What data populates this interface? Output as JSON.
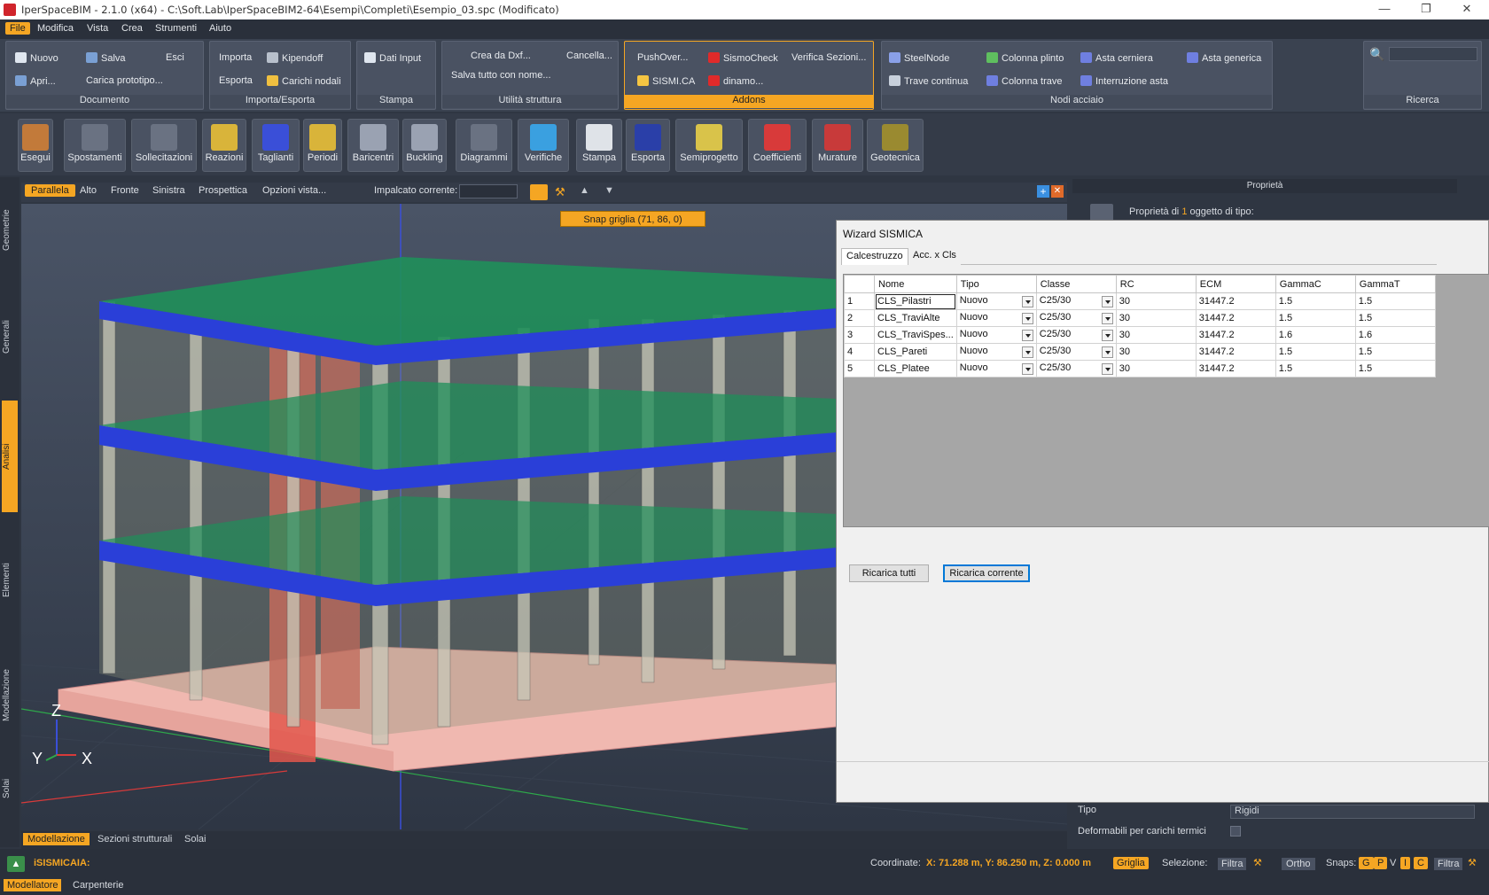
{
  "titlebar": {
    "title": "IperSpaceBIM - 2.1.0 (x64) - C:\\Soft.Lab\\IperSpaceBIM2-64\\Esempi\\Completi\\Esempio_03.spc (Modificato)"
  },
  "menu": [
    "File",
    "Modifica",
    "Vista",
    "Crea",
    "Strumenti",
    "Aiuto"
  ],
  "ribbon": {
    "documento": {
      "label": "Documento",
      "nuovo": "Nuovo",
      "salva": "Salva",
      "esci": "Esci",
      "apri": "Apri...",
      "carica": "Carica prototipo..."
    },
    "importa": {
      "label": "Importa/Esporta",
      "importa": "Importa",
      "kipendoff": "Kipendoff",
      "esporta": "Esporta",
      "carichi": "Carichi nodali"
    },
    "stampa": {
      "label": "Stampa",
      "dati": "Dati Input"
    },
    "utilita": {
      "label": "Utilità struttura",
      "crea": "Crea da Dxf...",
      "cancella": "Cancella...",
      "salvatutto": "Salva tutto con nome..."
    },
    "addons": {
      "label": "Addons",
      "push": "PushOver...",
      "sismo": "SismoCheck",
      "verifica": "Verifica Sezioni...",
      "sismica": "SISMI.CA",
      "dinamo": "dinamo..."
    },
    "nodi": {
      "label": "Nodi acciaio",
      "steel": "SteelNode",
      "plinto": "Colonna plinto",
      "cerniera": "Asta cerniera",
      "generica": "Asta generica",
      "trave": "Trave continua",
      "coltrave": "Colonna trave",
      "interruzione": "Interruzione asta"
    },
    "ricerca": {
      "label": "Ricerca"
    }
  },
  "toolbar": [
    "Esegui",
    "Spostamenti",
    "Sollecitazioni",
    "Reazioni",
    "Taglianti",
    "Periodi",
    "Baricentri",
    "Buckling",
    "Diagrammi",
    "Verifiche",
    "Stampa",
    "Esporta",
    "Semiprogetto",
    "Coefficienti",
    "Murature",
    "Geotecnica"
  ],
  "lefttabs": [
    "Geometrie",
    "Generali",
    "Analisi",
    "Elementi",
    "Modellazione",
    "Solai"
  ],
  "viewbar": {
    "parallela": "Parallela",
    "alto": "Alto",
    "fronte": "Fronte",
    "sinistra": "Sinistra",
    "prospettica": "Prospettica",
    "opzioni": "Opzioni vista...",
    "impalcato": "Impalcato corrente:"
  },
  "snap": "Snap griglia (71, 86, 0)",
  "axes": {
    "z": "Z",
    "y": "Y",
    "x": "X"
  },
  "bottomtabs": [
    "Modellazione",
    "Sezioni strutturali",
    "Solai"
  ],
  "properties": {
    "header": "Proprietà",
    "caption_pre": "Proprietà di ",
    "count": "1",
    "caption_post": " oggetto di tipo:",
    "tipo_label": "Tipo",
    "tipo_value": "Rigidi",
    "deformabili": "Deformabili per carichi termici"
  },
  "wizard": {
    "title": "Wizard SISMICA",
    "tabs": [
      "Calcestruzzo",
      "Acc. x Cls"
    ],
    "columns": [
      "Nome",
      "Tipo",
      "Classe",
      "RC",
      "ECM",
      "GammaC",
      "GammaT"
    ],
    "rows": [
      {
        "n": "1",
        "nome": "CLS_Pilastri",
        "tipo": "Nuovo",
        "classe": "C25/30",
        "rc": "30",
        "ecm": "31447.2",
        "gc": "1.5",
        "gt": "1.5"
      },
      {
        "n": "2",
        "nome": "CLS_TraviAlte",
        "tipo": "Nuovo",
        "classe": "C25/30",
        "rc": "30",
        "ecm": "31447.2",
        "gc": "1.5",
        "gt": "1.5"
      },
      {
        "n": "3",
        "nome": "CLS_TraviSpes...",
        "tipo": "Nuovo",
        "classe": "C25/30",
        "rc": "30",
        "ecm": "31447.2",
        "gc": "1.6",
        "gt": "1.6"
      },
      {
        "n": "4",
        "nome": "CLS_Pareti",
        "tipo": "Nuovo",
        "classe": "C25/30",
        "rc": "30",
        "ecm": "31447.2",
        "gc": "1.5",
        "gt": "1.5"
      },
      {
        "n": "5",
        "nome": "CLS_Platee",
        "tipo": "Nuovo",
        "classe": "C25/30",
        "rc": "30",
        "ecm": "31447.2",
        "gc": "1.5",
        "gt": "1.5"
      }
    ],
    "btn_all": "Ricarica tutti",
    "btn_current": "Ricarica corrente"
  },
  "status": {
    "mode": "iSISMICAIA:",
    "coord_label": "Coordinate:",
    "coord_value": "X: 71.288 m, Y: 86.250 m, Z: 0.000 m",
    "griglia": "Griglia",
    "selezione": "Selezione:",
    "filtra": "Filtra",
    "ortho": "Ortho",
    "snaps": "Snaps:",
    "snap_keys": [
      "G",
      "P",
      "V",
      "I",
      "C"
    ],
    "filtra2": "Filtra",
    "tab1": "Modellatore",
    "tab2": "Carpenterie"
  },
  "colors": {
    "accent": "#f5a623",
    "beam": "#2a3fd8",
    "slab": "#1f8f5a",
    "wall": "#e2574c",
    "base": "#f2b7b0"
  }
}
